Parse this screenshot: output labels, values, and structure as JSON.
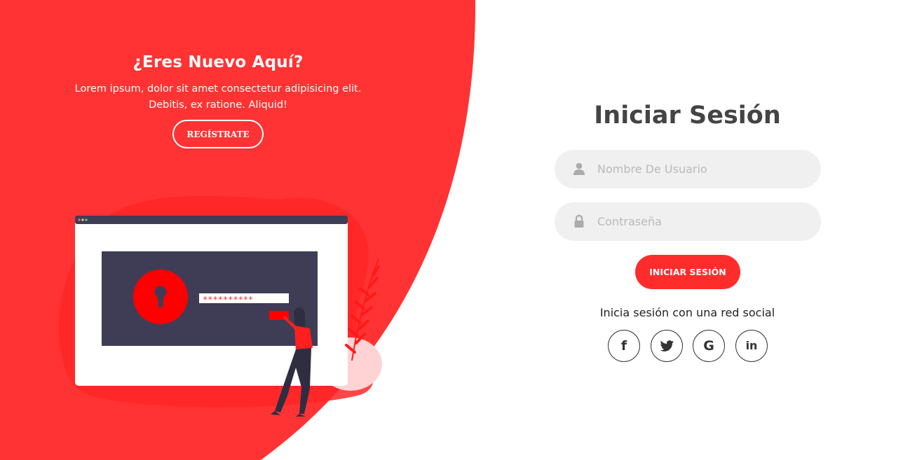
{
  "signup_panel": {
    "title": "¿Eres Nuevo Aquí?",
    "text_line1": "Lorem ipsum, dolor sit amet consectetur adipisicing elit.",
    "text_line2": "Debitis, ex ratione. Aliquid!",
    "register_label": "Regístrate"
  },
  "illustration": {
    "password_mask": "**********"
  },
  "login_form": {
    "title": "Iniciar Sesión",
    "username_placeholder": "Nombre De Usuario",
    "password_placeholder": "Contraseña",
    "submit_label": "Iniciar Sesión",
    "social_text": "Inicia sesión con una red social"
  },
  "social": {
    "facebook": "f",
    "google": "G",
    "linkedin": "in"
  },
  "colors": {
    "accent": "#ff2c2c",
    "text_dark": "#444444",
    "input_bg": "#f0f0f0",
    "illustration_panel": "#3f3d56"
  },
  "icons": [
    "user-icon",
    "lock-icon",
    "facebook-icon",
    "twitter-icon",
    "google-icon",
    "linkedin-icon"
  ]
}
